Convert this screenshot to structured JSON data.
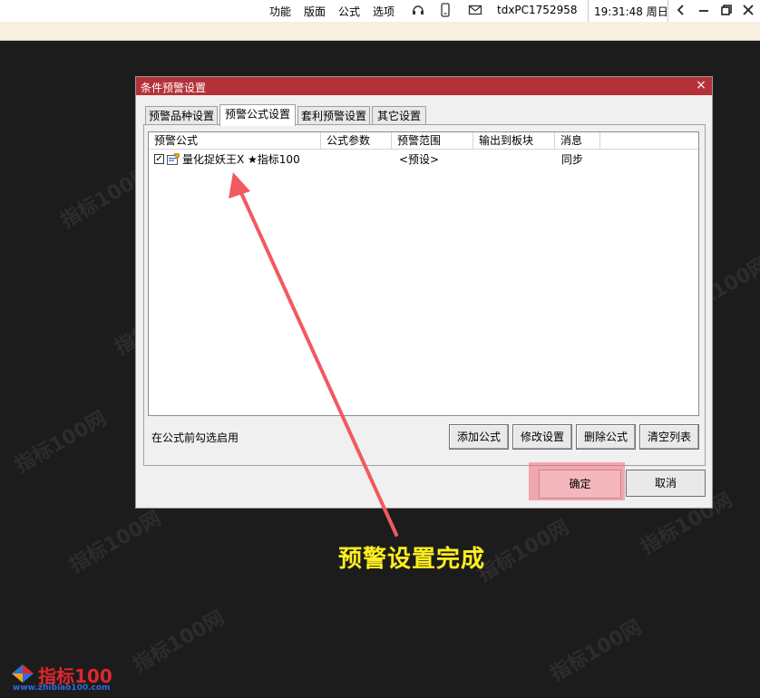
{
  "topbar": {
    "menu": [
      "功能",
      "版面",
      "公式",
      "选项"
    ],
    "user": "tdxPC1752958",
    "clock": "19:31:48 周日",
    "icons": [
      "headset-icon",
      "phone-icon",
      "mail-icon",
      "chevron-left-icon",
      "minimize-icon",
      "restore-icon",
      "close-icon"
    ]
  },
  "watermark": "指标100网",
  "dialog": {
    "title": "条件预警设置",
    "close": "×",
    "tabs": [
      "预警品种设置",
      "预警公式设置",
      "套利预警设置",
      "其它设置"
    ],
    "active_tab": "预警公式设置",
    "columns": [
      "预警公式",
      "公式参数",
      "预警范围",
      "输出到板块",
      "消息"
    ],
    "rows": [
      {
        "checked": true,
        "check_mark": "✓",
        "formula": "量化捉妖王X ★指标100",
        "params": "",
        "range": "<预设>",
        "board": "",
        "message": "同步"
      }
    ],
    "hint": "在公式前勾选启用",
    "buttons": {
      "add": "添加公式",
      "modify": "修改设置",
      "delete": "删除公式",
      "clear": "清空列表"
    },
    "ok": "确定",
    "cancel": "取消"
  },
  "caption": "预警设置完成",
  "logo": {
    "name": "指标100",
    "url": "www.zhibiao100.com"
  },
  "colors": {
    "titlebar": "#b5313a",
    "caption": "#ffef1f",
    "arrow": "#f15a60"
  }
}
